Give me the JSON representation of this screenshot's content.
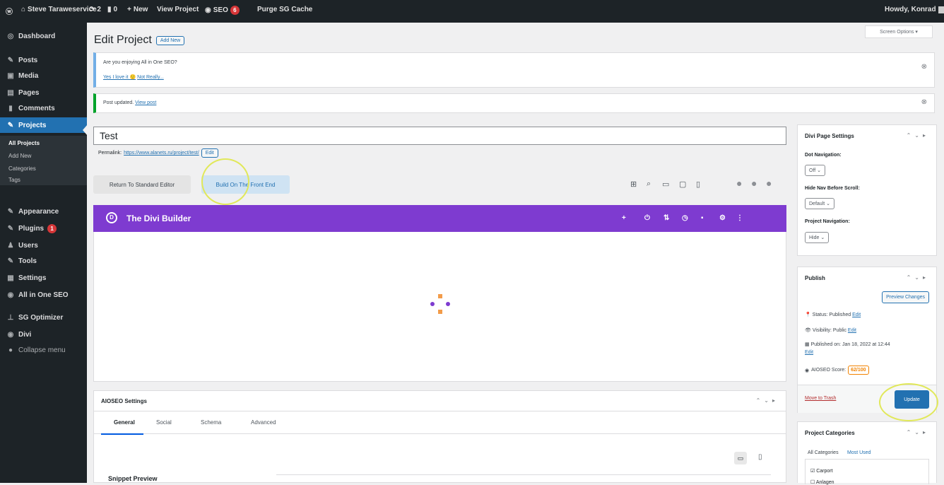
{
  "admin_bar": {
    "wp_logo": "wp-icon",
    "site": "Steve Taraweservice",
    "updates": "2",
    "comments": "0",
    "new": "New",
    "view": "View Project",
    "seo": "SEO",
    "seo_badge": "6",
    "purge": "Purge SG Cache",
    "howdy": "Howdy, Konrad"
  },
  "menu": {
    "items": [
      {
        "label": "Dashboard",
        "icon": "◎"
      },
      {
        "label": "Posts",
        "icon": "✎"
      },
      {
        "label": "Media",
        "icon": "▣"
      },
      {
        "label": "Pages",
        "icon": "▤"
      },
      {
        "label": "Comments",
        "icon": "▮"
      },
      {
        "label": "Projects",
        "icon": "✎"
      },
      {
        "label": "Appearance",
        "icon": "✎"
      },
      {
        "label": "Plugins",
        "icon": "✎"
      },
      {
        "label": "Users",
        "icon": "♟"
      },
      {
        "label": "Tools",
        "icon": "✎"
      },
      {
        "label": "Settings",
        "icon": "▦"
      },
      {
        "label": "All in One SEO",
        "icon": "◉"
      },
      {
        "label": "SG Optimizer",
        "icon": "⊥"
      },
      {
        "label": "Divi",
        "icon": "◉"
      },
      {
        "label": "Collapse menu",
        "icon": "●"
      }
    ],
    "plugins_badge": "1",
    "sub": [
      "All Projects",
      "Add New",
      "Categories",
      "Tags"
    ]
  },
  "screen_options": "Screen Options ▾",
  "page": {
    "title": "Edit Project",
    "add_new": "Add New"
  },
  "notice1": {
    "text": "Are you enjoying All in One SEO?",
    "yes": "Yes I love it 🙂",
    "no": "Not Really..."
  },
  "notice2": {
    "text": "Post updated.",
    "link": "View post"
  },
  "post_title": "Test",
  "permalink": {
    "label": "Permalink:",
    "url": "https://www.alanets.ru/project/test/",
    "edit": "Edit"
  },
  "buttons": {
    "return": "Return To Standard Editor",
    "build": "Build On The Front End"
  },
  "divi": {
    "title": "The Divi Builder",
    "logo": "D"
  },
  "aioseo": {
    "title": "AIOSEO Settings",
    "tabs": [
      "General",
      "Social",
      "Schema",
      "Advanced"
    ],
    "snippet": "Snippet Preview"
  },
  "divi_settings": {
    "title": "Divi Page Settings",
    "dot_label": "Dot Navigation:",
    "dot_val": "Off",
    "hide_label": "Hide Nav Before Scroll:",
    "hide_val": "Default",
    "proj_label": "Project Navigation:",
    "proj_val": "Hide"
  },
  "publish": {
    "title": "Publish",
    "preview": "Preview Changes",
    "status": "Status: Published",
    "status_edit": "Edit",
    "vis": "Visibility: Public",
    "vis_edit": "Edit",
    "pub": "Published on: Jan 18, 2022 at 12:44",
    "pub_edit": "Edit",
    "score_label": "AIOSEO Score:",
    "score": "62/100",
    "trash": "Move to Trash",
    "update": "Update"
  },
  "categories": {
    "title": "Project Categories",
    "tab_all": "All Categories",
    "tab_used": "Most Used",
    "items": [
      "Carport",
      "Anlagen"
    ]
  }
}
